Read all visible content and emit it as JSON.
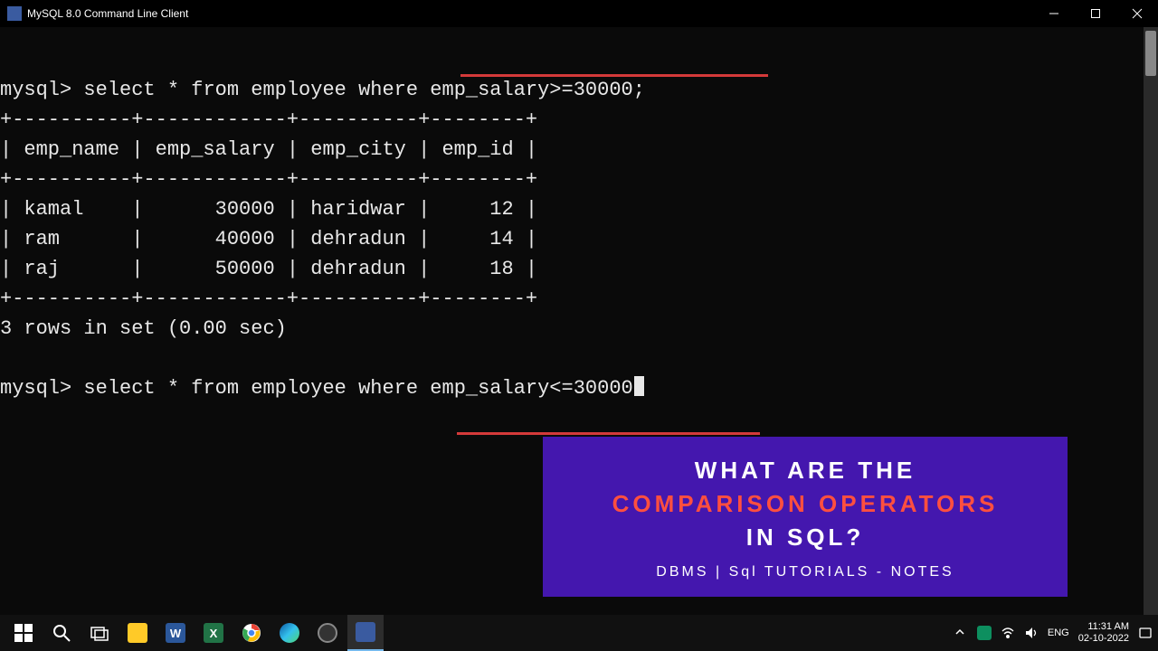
{
  "window": {
    "title": "MySQL 8.0 Command Line Client"
  },
  "terminal": {
    "prompt": "mysql>",
    "query1": "select * from employee where emp_salary>=30000;",
    "query2": "select * from employee where emp_salary<=30000",
    "result_summary": "3 rows in set (0.00 sec)",
    "border_top": "+----------+------------+----------+--------+",
    "header_row": "| emp_name | emp_salary | emp_city | emp_id |",
    "border_mid": "+----------+------------+----------+--------+",
    "rows": [
      "| kamal    |      30000 | haridwar |     12 |",
      "| ram      |      40000 | dehradun |     14 |",
      "| raj      |      50000 | dehradun |     18 |"
    ],
    "border_bot": "+----------+------------+----------+--------+"
  },
  "overlay": {
    "line1": "WHAT ARE THE",
    "line2": "COMPARISON OPERATORS",
    "line3": "IN SQL?",
    "sub": "DBMS | Sql TUTORIALS - NOTES"
  },
  "taskbar": {
    "lang": "ENG",
    "time": "11:31 AM",
    "date": "02-10-2022"
  },
  "icons": {
    "start": "start-icon",
    "search": "search-icon",
    "taskview": "taskview-icon",
    "explorer": "folder-icon",
    "word": "word-icon",
    "excel": "excel-icon",
    "chrome": "chrome-icon",
    "edge": "edge-icon",
    "obs": "obs-icon",
    "mysql": "mysql-icon",
    "chevron": "chevron-up-icon",
    "meet": "meet-icon",
    "wifi": "wifi-icon",
    "sound": "sound-icon",
    "notif": "notification-icon"
  }
}
